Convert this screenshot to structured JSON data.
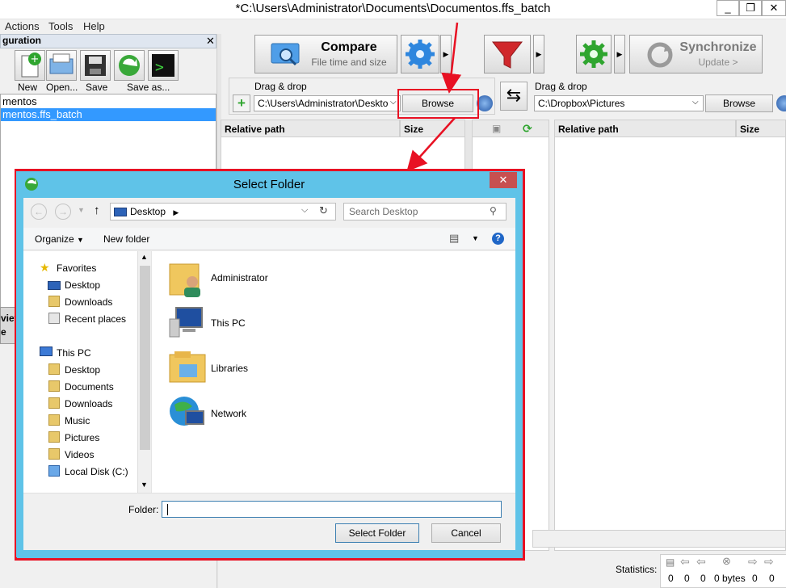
{
  "window": {
    "title": "*C:\\Users\\Administrator\\Documents\\Documentos.ffs_batch",
    "controls": [
      "_",
      "❐",
      "✕"
    ]
  },
  "menu": [
    "Actions",
    "Tools",
    "Help"
  ],
  "config_panel": {
    "header": "guration",
    "toolbar": [
      {
        "label": "New",
        "icon": "new-config-icon"
      },
      {
        "label": "Open...",
        "icon": "open-config-icon"
      },
      {
        "label": "Save",
        "icon": "save-icon"
      },
      {
        "label": "Save as...",
        "icon": "save-as-icon"
      }
    ],
    "items": [
      {
        "label": "mentos",
        "selected": false
      },
      {
        "label": "mentos.ffs_batch",
        "selected": true
      }
    ],
    "left_strip": [
      "view",
      "e"
    ]
  },
  "toolbar": {
    "compare_title": "Compare",
    "compare_sub": "File time and size",
    "sync_title": "Synchronize",
    "sync_sub": "Update >"
  },
  "left_folder": {
    "dragdrop": "Drag & drop",
    "path": "C:\\Users\\Administrator\\Deskto",
    "browse": "Browse"
  },
  "right_folder": {
    "dragdrop": "Drag & drop",
    "path": "C:\\Dropbox\\Pictures",
    "browse": "Browse"
  },
  "grid": {
    "left_headers": [
      "Relative path",
      "Size"
    ],
    "right_headers": [
      "Relative path",
      "Size"
    ]
  },
  "status": {
    "label": "Statistics:",
    "counts": [
      "0",
      "0",
      "0",
      "0 bytes",
      "0",
      "0"
    ]
  },
  "dialog": {
    "title": "Select Folder",
    "close": "✕",
    "address": "Desktop",
    "search_placeholder": "Search Desktop",
    "organize": "Organize",
    "new_folder": "New folder",
    "nav": {
      "favorites": "Favorites",
      "favorites_items": [
        "Desktop",
        "Downloads",
        "Recent places"
      ],
      "thispc": "This PC",
      "thispc_items": [
        "Desktop",
        "Documents",
        "Downloads",
        "Music",
        "Pictures",
        "Videos",
        "Local Disk (C:)"
      ]
    },
    "files": [
      "Administrator",
      "This PC",
      "Libraries",
      "Network"
    ],
    "folder_label": "Folder:",
    "folder_value": "",
    "select_button": "Select Folder",
    "cancel_button": "Cancel"
  },
  "colors": {
    "dialog_frame": "#5fc3e8",
    "annotation_red": "#e81123",
    "selection": "#3399ff"
  }
}
